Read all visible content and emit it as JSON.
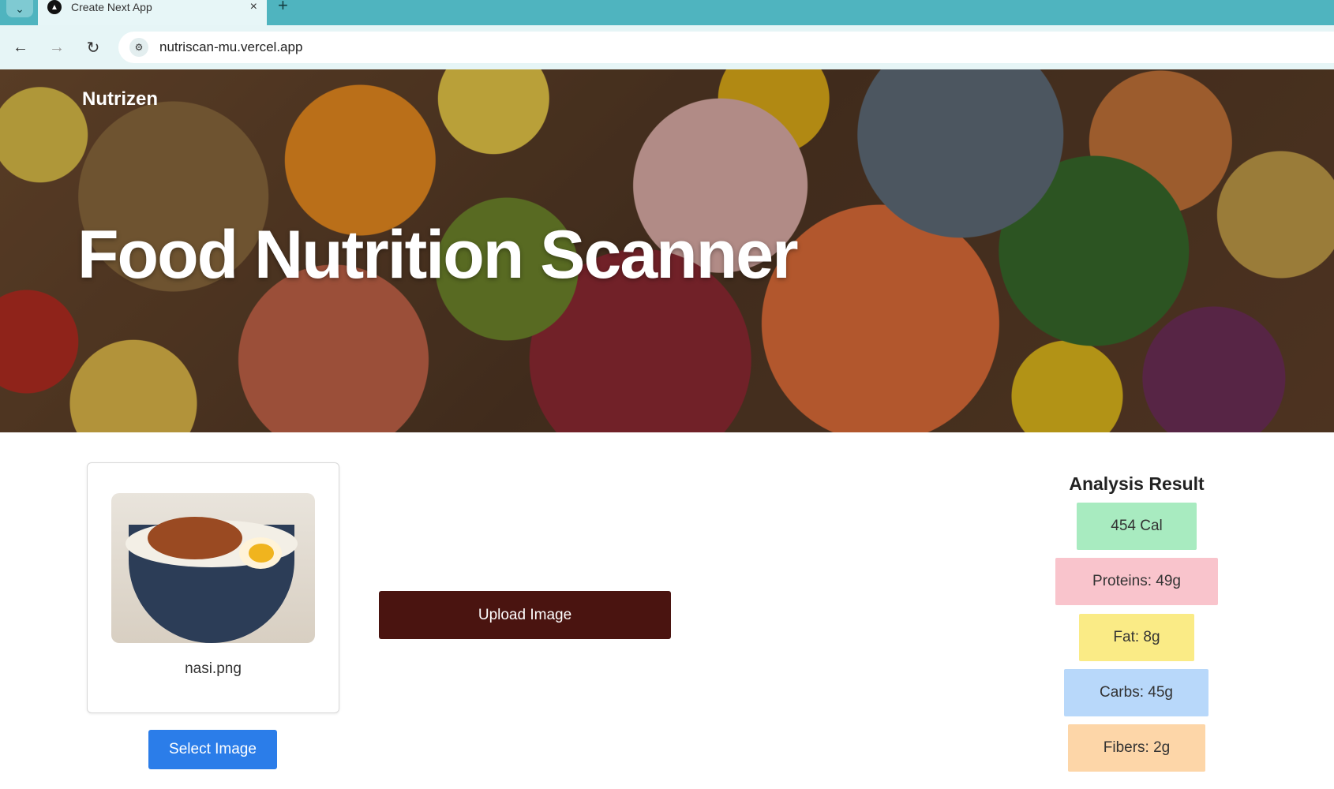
{
  "browser": {
    "tab_title": "Create Next App",
    "tab_close": "×",
    "new_tab": "+",
    "menu_icon": "⌄",
    "url": "nutriscan-mu.vercel.app",
    "back_icon": "←",
    "forward_icon": "→",
    "reload_icon": "↻",
    "site_info_icon": "⚙"
  },
  "header": {
    "brand": "Nutrizen",
    "title": "Food Nutrition Scanner"
  },
  "upload": {
    "filename": "nasi.png",
    "select_label": "Select Image",
    "upload_label": "Upload Image"
  },
  "results": {
    "title": "Analysis Result",
    "calories": "454 Cal",
    "proteins": "Proteins: 49g",
    "fat": "Fat: 8g",
    "carbs": "Carbs: 45g",
    "fibers": "Fibers: 2g"
  },
  "colors": {
    "accent_blue": "#2b7de9",
    "upload_brown": "#4a1410",
    "calories_bg": "#a8ebc0",
    "proteins_bg": "#f9c4cc",
    "fat_bg": "#faeb86",
    "carbs_bg": "#b8d8fa",
    "fibers_bg": "#fdd6a8",
    "browser_teal": "#4fb4bf"
  }
}
